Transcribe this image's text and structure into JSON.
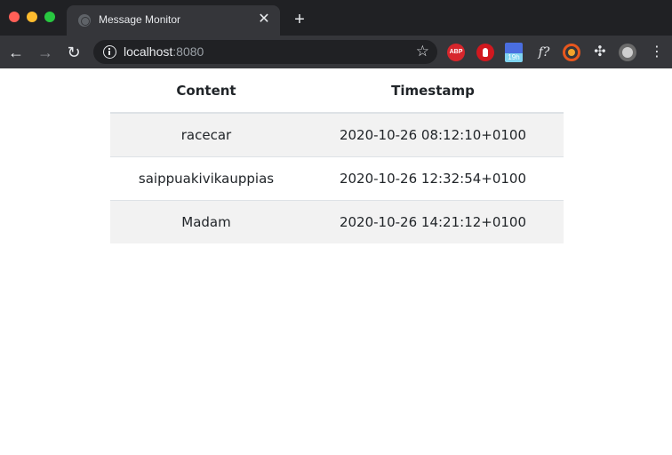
{
  "browser": {
    "tab": {
      "title": "Message Monitor",
      "close_glyph": "✕"
    },
    "new_tab_glyph": "+",
    "nav": {
      "back_glyph": "←",
      "forward_glyph": "→",
      "reload_glyph": "↻"
    },
    "address": {
      "host": "localhost",
      "port": ":8080"
    },
    "extensions": {
      "abp_label": "ABP",
      "calendar_label": "19h",
      "f_label": "f?"
    },
    "menu_glyph": "⋮",
    "colors": {
      "frame": "#202124",
      "toolbar": "#35363a"
    }
  },
  "messages": {
    "headers": {
      "content": "Content",
      "timestamp": "Timestamp"
    },
    "rows": [
      {
        "content": "racecar",
        "timestamp": "2020-10-26 08:12:10+0100"
      },
      {
        "content": "saippuakivikauppias",
        "timestamp": "2020-10-26 12:32:54+0100"
      },
      {
        "content": "Madam",
        "timestamp": "2020-10-26 14:21:12+0100"
      }
    ]
  }
}
